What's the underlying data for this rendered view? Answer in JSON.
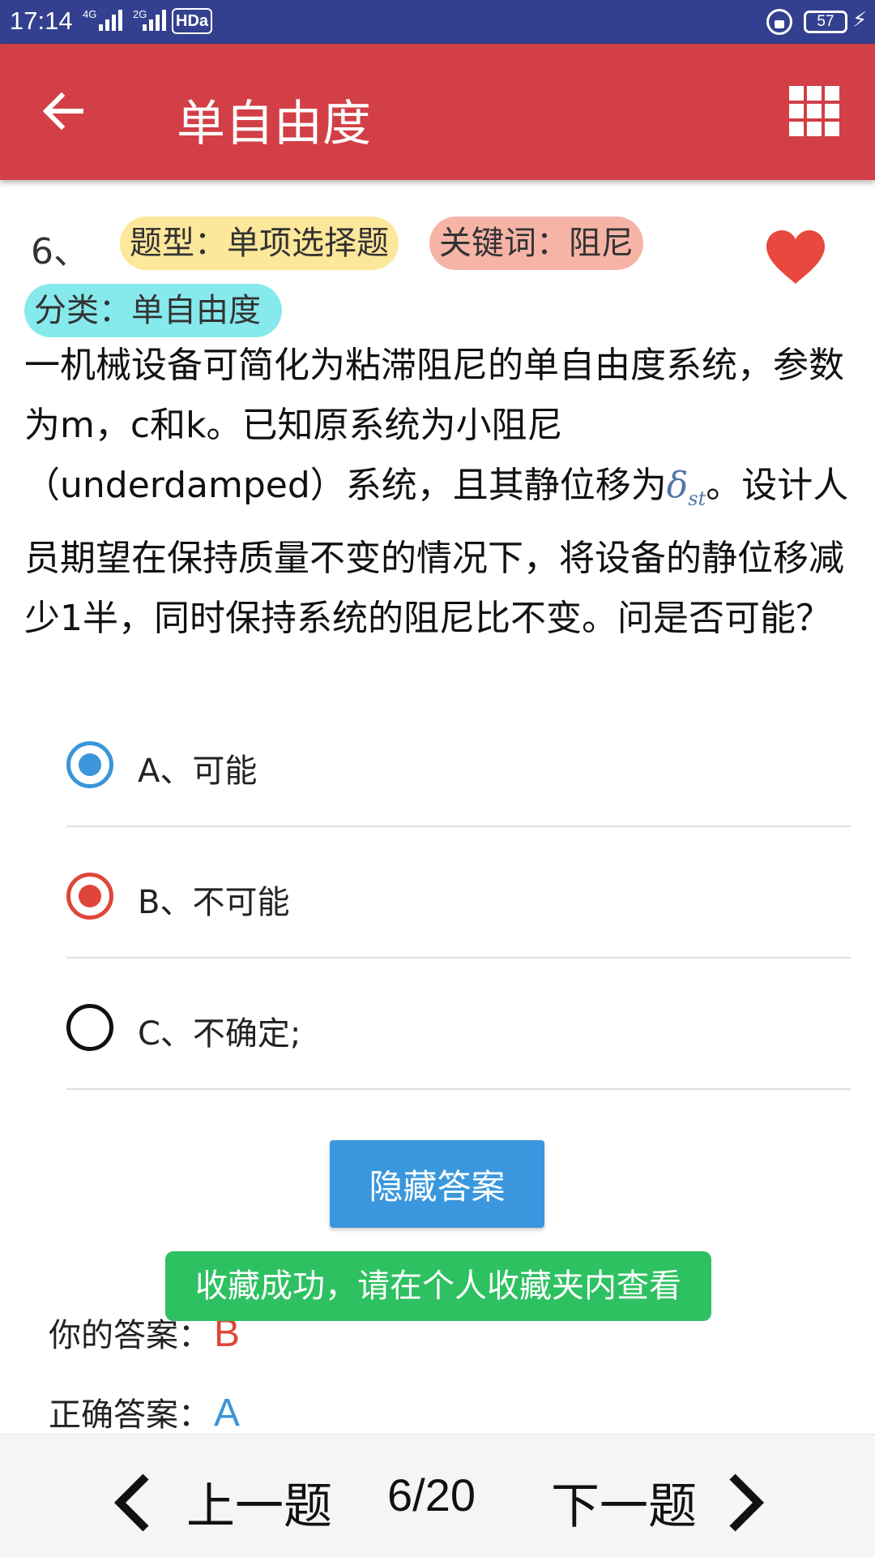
{
  "status_bar": {
    "time": "17:14",
    "signal_1_label": "4G",
    "signal_2_label": "2G",
    "hd_label": "HDa",
    "battery": "57",
    "icons": [
      "lock-rotation-icon",
      "battery-icon",
      "charging-icon"
    ]
  },
  "app_bar": {
    "title": "单自由度",
    "icons": [
      "back-arrow-icon",
      "grid-menu-icon"
    ]
  },
  "question": {
    "number": "6、",
    "type_chip": "题型：单项选择题",
    "keyword_chip": "关键词：阻尼",
    "category_chip": "分类：单自由度",
    "favorited": true,
    "text_part1": "一机械设备可简化为粘滞阻尼的单自由度系统，参数为m，c和k。已知原系统为小阻尼（underdamped）系统，且其静位移为",
    "delta_symbol": "δ",
    "delta_subscript": "st",
    "text_part2": "。设计人员期望在保持质量不变的情况下，将设备的静位移减少1半，同时保持系统的阻尼比不变。问是否可能？"
  },
  "options": [
    {
      "label": "A、可能",
      "state": "correct"
    },
    {
      "label": "B、不可能",
      "state": "chosen-wrong"
    },
    {
      "label": "C、不确定;",
      "state": "unselected"
    }
  ],
  "hide_answer_button": "隐藏答案",
  "your_answer": {
    "label": "你的答案：",
    "value": "B"
  },
  "correct_answer": {
    "label": "正确答案：",
    "value": "A"
  },
  "toast": "收藏成功，请在个人收藏夹内查看",
  "bottom_nav": {
    "prev": "上一题",
    "counter": "6/20",
    "next": "下一题"
  },
  "colors": {
    "status_bar": "#33408f",
    "app_bar": "#d23f46",
    "correct_blue": "#3a95d9",
    "wrong_red": "#e0453a",
    "toast_green": "#2ec161",
    "heart": "#e8483d"
  }
}
